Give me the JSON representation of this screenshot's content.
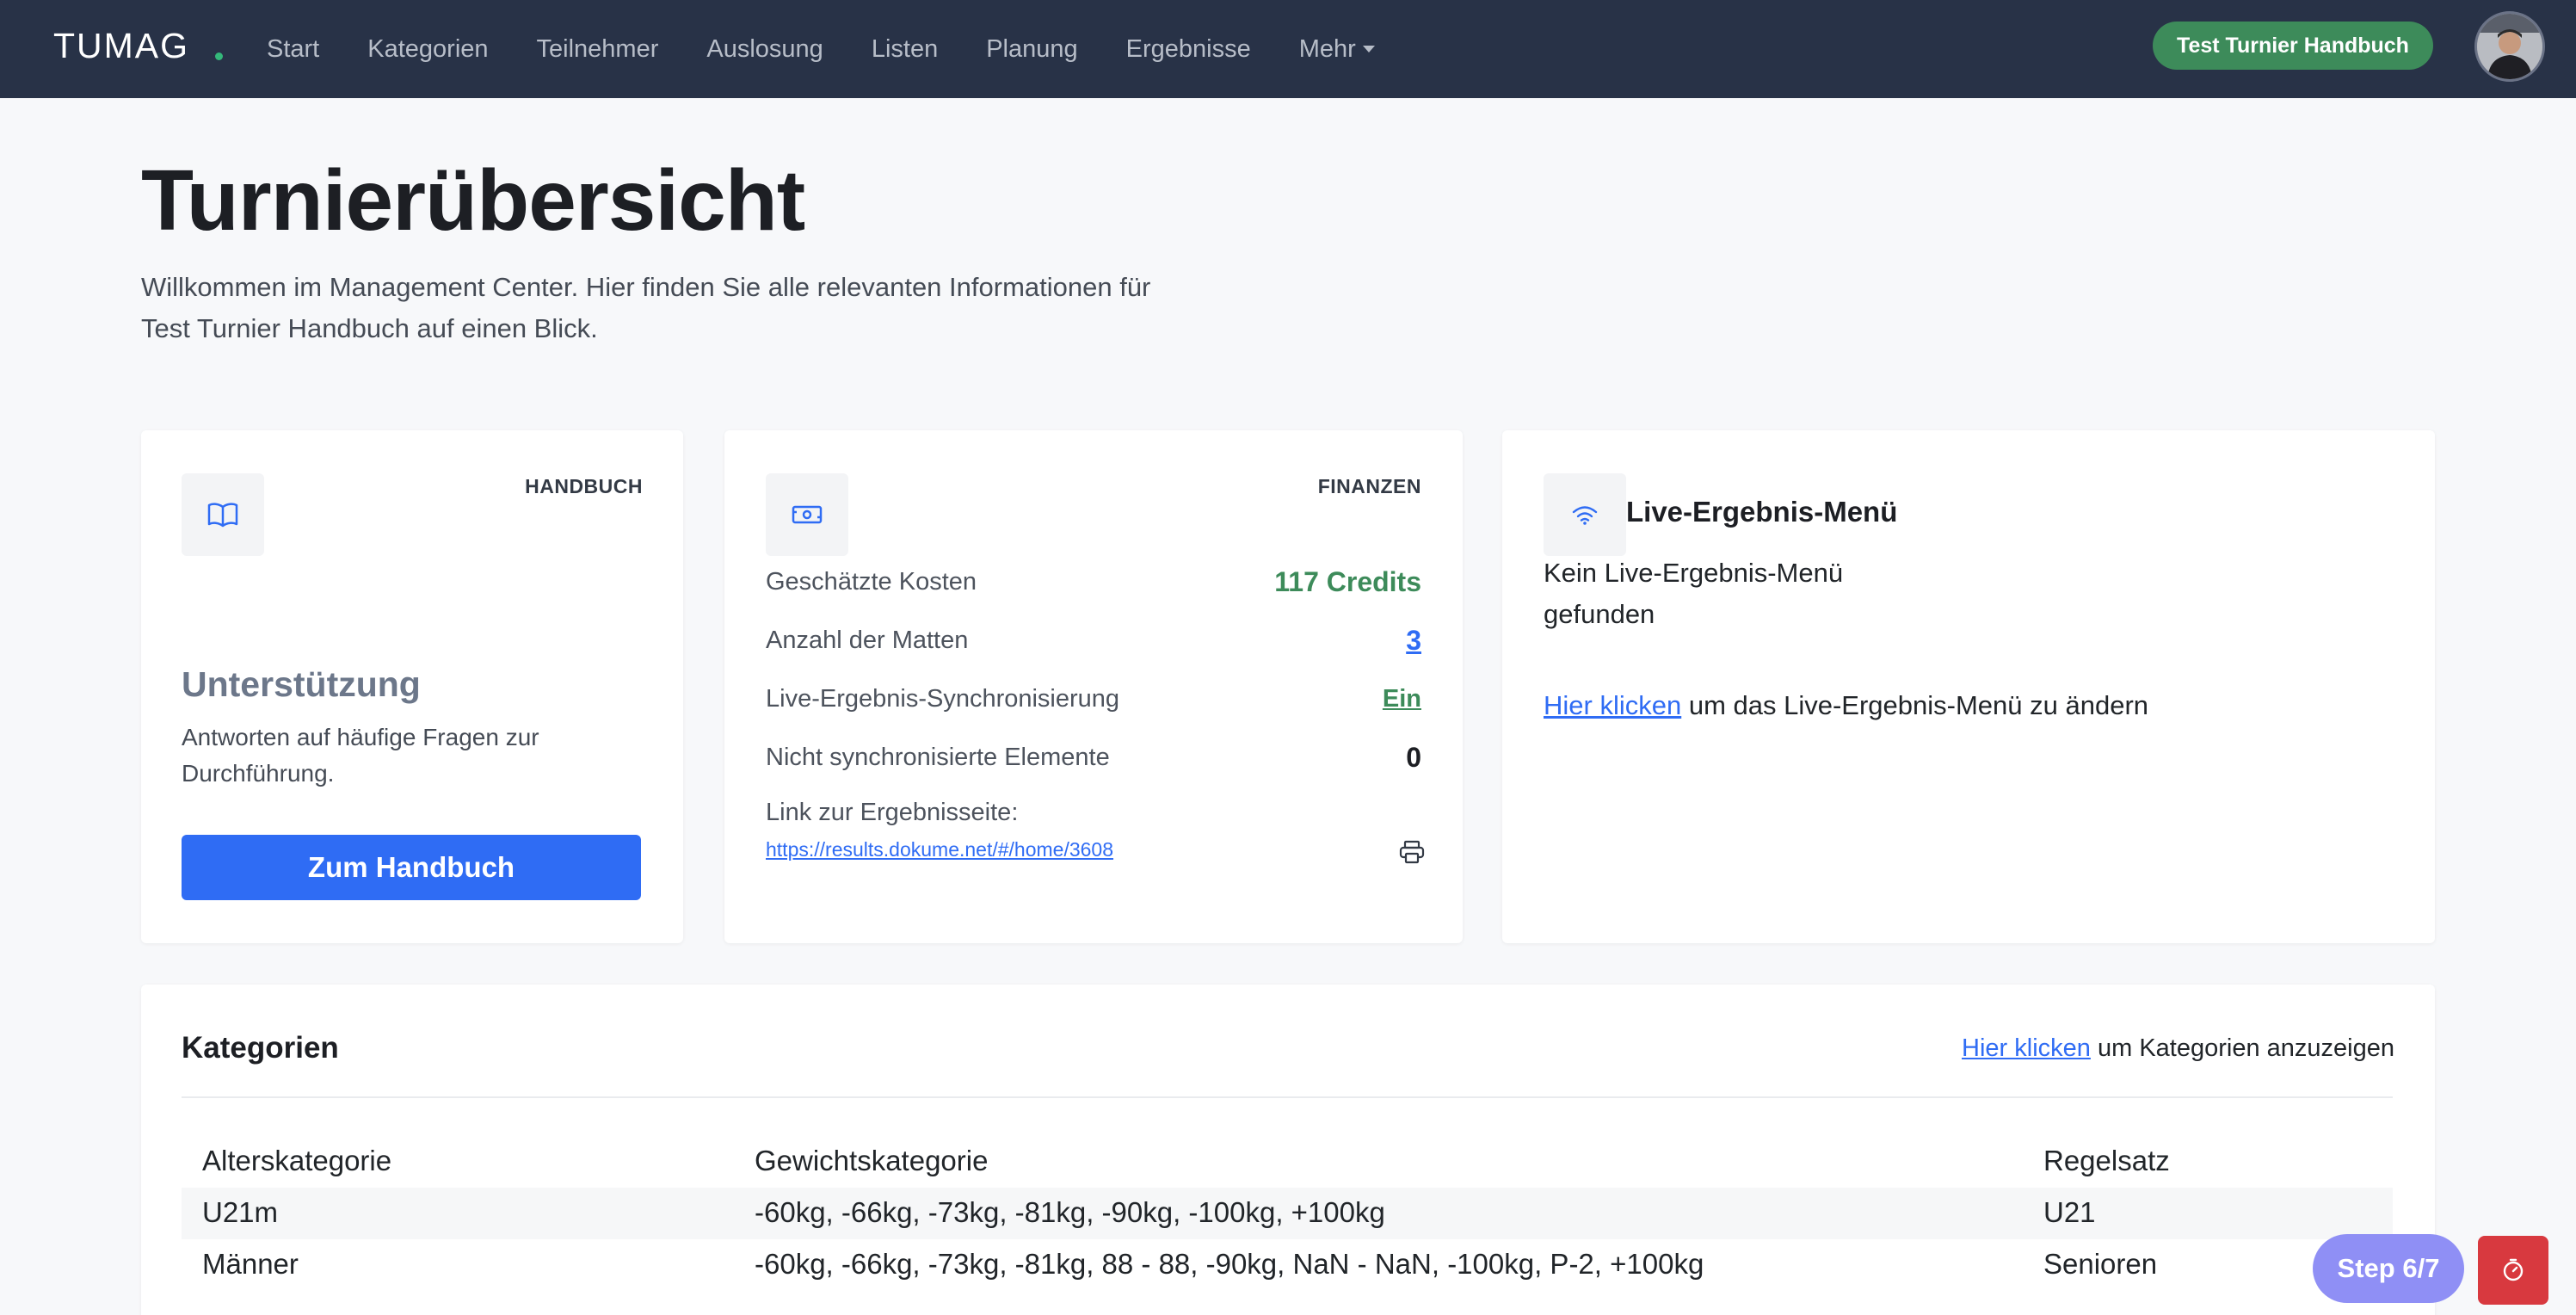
{
  "nav": {
    "brand": "TUMAG",
    "items": [
      "Start",
      "Kategorien",
      "Teilnehmer",
      "Auslosung",
      "Listen",
      "Planung",
      "Ergebnisse"
    ],
    "more_label": "Mehr",
    "tournament_badge": "Test Turnier Handbuch"
  },
  "header": {
    "title": "Turnierübersicht",
    "intro_line1": "Willkommen im Management Center. Hier finden Sie alle relevanten Informationen für",
    "intro_line2": "Test Turnier Handbuch auf einen Blick."
  },
  "handbook_card": {
    "tag": "HANDBUCH",
    "title": "Unterstützung",
    "description": "Antworten auf häufige Fragen zur Durchführung.",
    "button_label": "Zum Handbuch"
  },
  "finance_card": {
    "tag": "FINANZEN",
    "rows": [
      {
        "label": "Geschätzte Kosten",
        "value": "117 Credits"
      },
      {
        "label": "Anzahl der Matten",
        "value": "3"
      },
      {
        "label": "Live-Ergebnis-Synchronisierung",
        "value": "Ein"
      },
      {
        "label": "Nicht synchronisierte Elemente",
        "value": "0"
      }
    ],
    "result_link_label": "Link zur Ergebnisseite:",
    "result_link_url": "https://results.dokume.net/#/home/3608"
  },
  "live_card": {
    "title": "Live-Ergebnis-Menü",
    "empty_text": "Kein Live-Ergebnis-Menü gefunden",
    "action_link": "Hier klicken",
    "action_text": " um das Live-Ergebnis-Menü zu ändern"
  },
  "categories": {
    "title": "Kategorien",
    "action_link": "Hier klicken",
    "action_text": " um Kategorien anzuzeigen",
    "columns": [
      "Alterskategorie",
      "Gewichtskategorie",
      "Regelsatz"
    ],
    "rows": [
      [
        "U21m",
        "-60kg, -66kg, -73kg, -81kg, -90kg, -100kg, +100kg",
        "U21"
      ],
      [
        "Männer",
        "-60kg, -66kg, -73kg, -81kg, 88 - 88, -90kg, NaN - NaN, -100kg, P-2, +100kg",
        "Senioren"
      ]
    ]
  },
  "tour": {
    "step_label": "Step 6/7"
  },
  "colors": {
    "navbar": "#283247",
    "primary": "#2f6cf4",
    "success": "#3d8b5a",
    "step": "#8f8ff5",
    "danger": "#d8393f"
  }
}
